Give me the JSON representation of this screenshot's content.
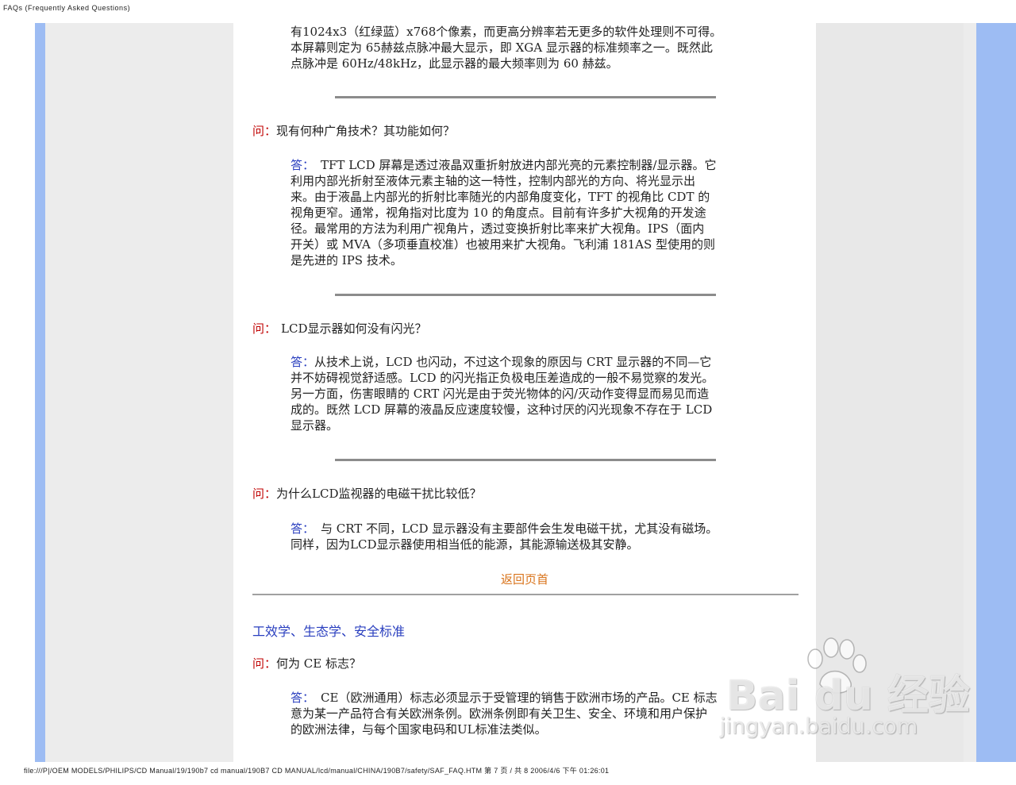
{
  "print_header": "FAQs (Frequently Asked Questions)",
  "print_footer": "file:///P|/OEM MODELS/PHILIPS/CD Manual/19/190b7 cd manual/190B7 CD MANUAL/lcd/manual/CHINA/190B7/safety/SAF_FAQ.HTM 第 7 页 / 共 8 2006/4/6 下午 01:26:01",
  "intro_lines": [
    "有1024x3（红绿蓝）x768个像素，而更高分辨率若无更多的软件处理则不可得。",
    "本屏幕则定为 65赫兹点脉冲最大显示，即 XGA 显示器的标准频率之一。既然此",
    "点脉冲是 60Hz/48kHz，此显示器的最大频率则为 60 赫兹。"
  ],
  "faq": [
    {
      "q_label": "问：",
      "question": "现有何种广角技术？其功能如何？",
      "a_label": "答：",
      "answer_lines": [
        "TFT LCD 屏幕是透过液晶双重折射放进内部光亮的元素控制器/显示器。它",
        "利用内部光折射至液体元素主轴的这一特性，控制内部光的方向、将光显示出",
        "来。由于液晶上内部光的折射比率随光的内部角度变化，TFT 的视角比 CDT 的",
        "视角更窄。通常，视角指对比度为 10 的角度点。目前有许多扩大视角的开发途",
        "径。最常用的方法为利用广视角片，透过变换折射比率来扩大视角。IPS（面内",
        "开关）或 MVA（多项垂直校准）也被用来扩大视角。飞利浦 181AS 型使用的则",
        "是先进的 IPS 技术。"
      ]
    },
    {
      "q_label": "问：",
      "question": "LCD显示器如何没有闪光？",
      "a_label": "答：",
      "answer_lines": [
        "从技术上说，LCD 也闪动，不过这个现象的原因与 CRT 显示器的不同—它",
        "并不妨碍视觉舒适感。LCD 的闪光指正负极电压差造成的一般不易觉察的发光。",
        "另一方面，伤害眼睛的 CRT 闪光是由于荧光物体的闪/灭动作变得显而易见而造",
        "成的。既然 LCD 屏幕的液晶反应速度较慢，这种讨厌的闪光现象不存在于 LCD",
        "显示器。"
      ]
    },
    {
      "q_label": "问：",
      "question": "为什么LCD监视器的电磁干扰比较低？",
      "a_label": "答：",
      "answer_lines": [
        "与 CRT 不同，LCD 显示器没有主要部件会生发电磁干扰，尤其没有磁场。",
        "同样，因为LCD显示器使用相当低的能源，其能源输送极其安静。"
      ]
    }
  ],
  "back_to_top": "返回页首",
  "section_title": "工效学、生态学、安全标准",
  "ce": {
    "q_label": "问：",
    "question": "何为 CE 标志？",
    "a_label": "答：",
    "answer_lines": [
      "CE（欧洲通用）标志必须显示于受管理的销售于欧洲市场的产品。CE 标志",
      "意为某一产品符合有关欧洲条例。欧洲条例即有关卫生、安全、环境和用户保护",
      "的欧洲法律，与每个国家电码和UL标准法类似。"
    ]
  },
  "watermark": {
    "brand": "Bai du 经验",
    "url": "jingyan.baidu.com"
  }
}
